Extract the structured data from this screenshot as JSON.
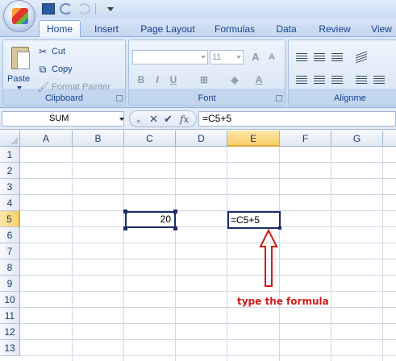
{
  "ribbon": {
    "tabs": [
      "Home",
      "Insert",
      "Page Layout",
      "Formulas",
      "Data",
      "Review",
      "View"
    ],
    "active_tab": "Home",
    "clipboard": {
      "paste_label": "Paste",
      "cut_label": "Cut",
      "copy_label": "Copy",
      "format_painter_label": "Format Painter",
      "group_label": "Clipboard"
    },
    "font": {
      "font_name": "",
      "font_size": "11",
      "grow_label": "A",
      "shrink_label": "A",
      "bold_label": "B",
      "italic_label": "I",
      "underline_label": "U",
      "font_color_label": "A",
      "group_label": "Font"
    },
    "alignment": {
      "group_label": "Alignme"
    }
  },
  "formula_bar": {
    "name_box": "SUM",
    "fx_label": "fx",
    "formula": "=C5+5"
  },
  "sheet": {
    "columns": [
      "A",
      "B",
      "C",
      "D",
      "E",
      "F",
      "G"
    ],
    "selected_column": "E",
    "rows": [
      "1",
      "2",
      "3",
      "4",
      "5",
      "6",
      "7",
      "8",
      "9",
      "10",
      "11",
      "12",
      "13"
    ],
    "selected_row": "5",
    "cells": {
      "C5": "20",
      "E5": "=C5+5"
    }
  },
  "annotation": {
    "text": "type the formula",
    "color": "#d11a1a"
  },
  "colors": {
    "accent": "#15428b",
    "header_selected": "#f9cf6a",
    "cell_border": "#1a2b66"
  }
}
